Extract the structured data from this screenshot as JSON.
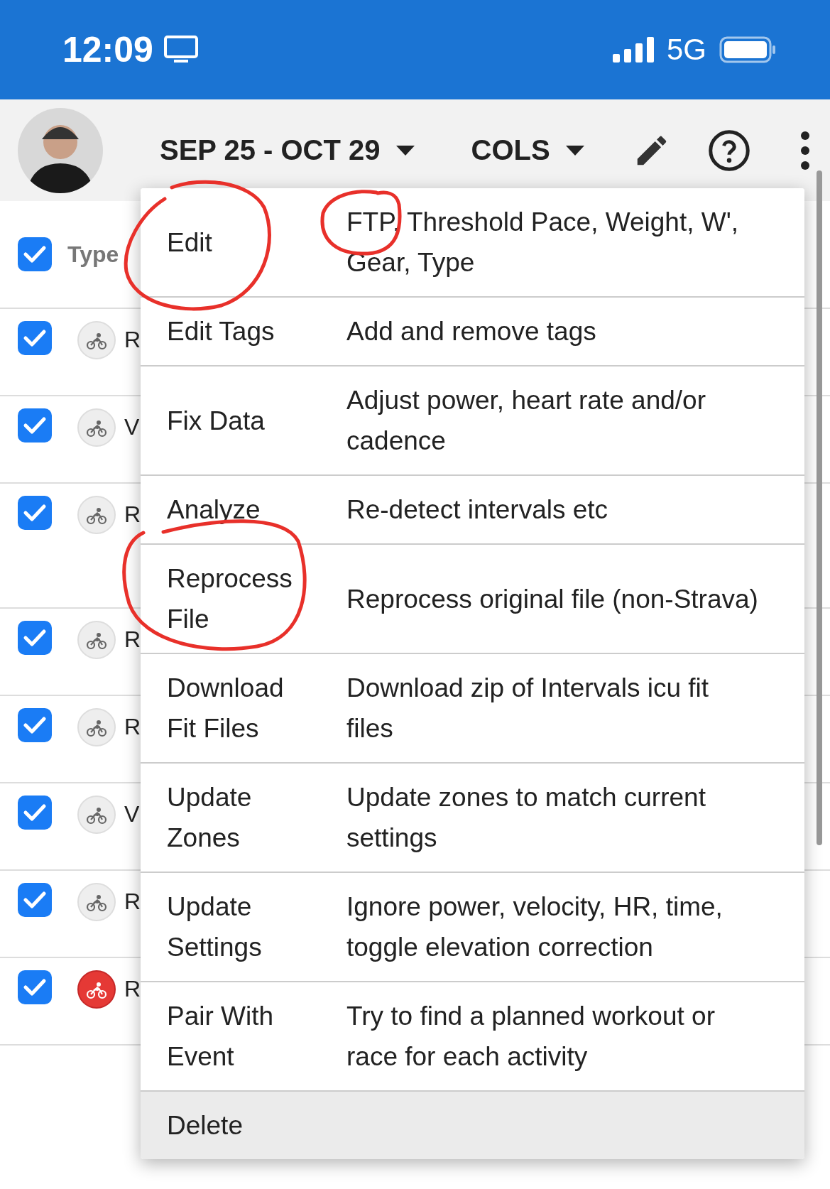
{
  "status_bar": {
    "time": "12:09",
    "network": "5G"
  },
  "toolbar": {
    "date_range": "SEP 25 - OCT 29",
    "columns_button": "COLS"
  },
  "table": {
    "header": {
      "checked": true,
      "type_label": "Type"
    },
    "rows": [
      {
        "checked": true,
        "race": false,
        "type": "R"
      },
      {
        "checked": true,
        "race": false,
        "type": "V"
      },
      {
        "checked": true,
        "race": false,
        "type": "R"
      },
      {
        "checked": true,
        "race": false,
        "type": "R"
      },
      {
        "checked": true,
        "race": false,
        "type": "R"
      },
      {
        "checked": true,
        "race": false,
        "type": "V"
      },
      {
        "checked": true,
        "race": false,
        "type": "R"
      },
      {
        "checked": true,
        "race": true,
        "type": "R"
      }
    ]
  },
  "menu": {
    "items": [
      {
        "label": "Edit",
        "description": "FTP, Threshold Pace, Weight, W',\nGear, Type",
        "highlighted": false
      },
      {
        "label": "Edit Tags",
        "description": "Add and remove tags",
        "highlighted": false
      },
      {
        "label": "Fix Data",
        "description": "Adjust power, heart rate and/or\ncadence",
        "highlighted": false
      },
      {
        "label": "Analyze",
        "description": "Re-detect intervals etc",
        "highlighted": false
      },
      {
        "label": "Reprocess File",
        "description": "Reprocess original file (non-Strava)",
        "highlighted": false
      },
      {
        "label": "Download Fit Files",
        "description": "Download zip of Intervals icu fit\nfiles",
        "highlighted": false
      },
      {
        "label": "Update Zones",
        "description": "Update zones to match current\nsettings",
        "highlighted": false
      },
      {
        "label": "Update Settings",
        "description": "Ignore power, velocity, HR, time,\ntoggle elevation correction",
        "highlighted": false
      },
      {
        "label": "Pair With Event",
        "description": "Try to find a planned workout or\nrace for each activity",
        "highlighted": false
      },
      {
        "label": "Delete",
        "highlighted": true
      }
    ]
  }
}
